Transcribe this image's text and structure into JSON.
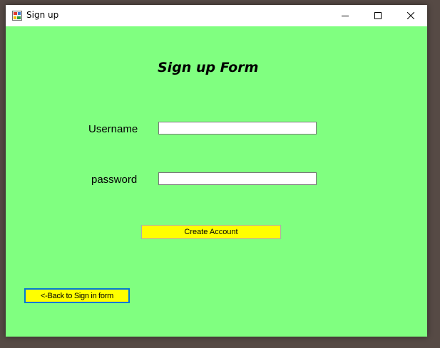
{
  "window": {
    "title": "Sign up",
    "controls": {
      "minimize": "minimize-icon",
      "maximize": "maximize-icon",
      "close": "close-icon"
    }
  },
  "form": {
    "heading": "Sign up Form",
    "username_label": "Username",
    "username_value": "",
    "password_label": "password",
    "password_value": "",
    "create_button": "Create Account",
    "back_button": "<-Back to Sign in form"
  },
  "colors": {
    "client_background": "#80ff80",
    "button_background": "#ffff00",
    "focus_border": "#0078d7"
  }
}
